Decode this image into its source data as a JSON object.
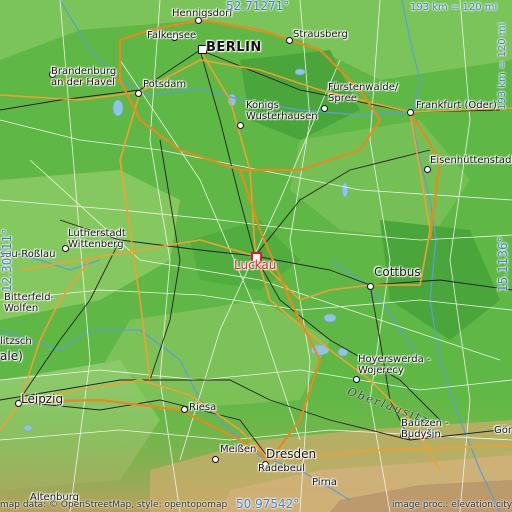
{
  "map": {
    "top_lat": "52.71271°",
    "bottom_lat": "50.97542°",
    "left_lon": "12.30111°",
    "right_lon": "15.1136°",
    "scale_top": "193 km = 120 mi",
    "scale_right": "193 km = 120 mi",
    "attribution_left": "map data: © OpenStreetMap, style: opentopomap",
    "attribution_right": "image proc.: elevation.city"
  },
  "places": {
    "hennigsdorf": "Hennigsdorf",
    "falkensee": "Falkensee",
    "berlin": "BERLIN",
    "strausberg": "Strausberg",
    "brandenburg": "Brandenburg\nan der Havel",
    "potsdam": "Potsdam",
    "fuerstenwalde": "Fürstenwalde/\nSpree",
    "frankfurt": "Frankfurt (Oder)",
    "koenigs": "Königs\nWusterhausen",
    "eisenhuettenstadt": "Eisenhüttenstadt",
    "lutherstadt": "Lutherstadt\nWittenberg",
    "rosslau": "sau-Roßlau",
    "luckau": "Luckau",
    "cottbus": "Cottbus",
    "bitterfeld": "Bitterfeld-\nWolfen",
    "delitzsch": "litzsch",
    "halle": "ale)",
    "hoyerswerda": "Hoyerswerda -\nWojerecy",
    "leipzig": "Leipzig",
    "riesa": "Riesa",
    "meissen": "Meißen",
    "radebeul": "Radebeul",
    "dresden": "Dresden",
    "pirna": "Pirna",
    "bautzen": "Bautzen -\nBudyšin",
    "goerlitz": "Gör",
    "altenburg": "Altenburg",
    "oberlausitz": "Oberlausitz"
  }
}
